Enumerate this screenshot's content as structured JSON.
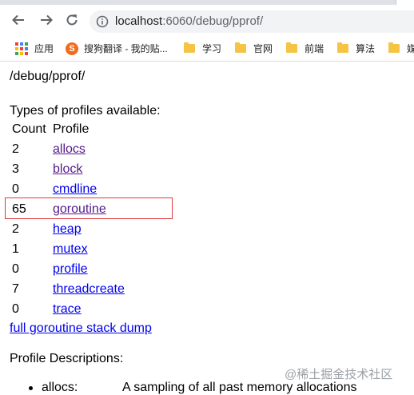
{
  "browser": {
    "url_host": "localhost",
    "url_rest": ":6060/debug/pprof/",
    "icons": [
      "back-arrow-icon",
      "forward-arrow-icon",
      "reload-icon",
      "info-icon"
    ]
  },
  "bookmarks": [
    {
      "label": "应用",
      "icon": "apps-grid-icon"
    },
    {
      "label": "搜狗翻译 - 我的贴...",
      "icon": "sogou-icon"
    },
    {
      "label": "学习",
      "icon": "folder-icon"
    },
    {
      "label": "官网",
      "icon": "folder-icon"
    },
    {
      "label": "前端",
      "icon": "folder-icon"
    },
    {
      "label": "算法",
      "icon": "folder-icon"
    },
    {
      "label": "媒",
      "icon": "folder-icon"
    }
  ],
  "page": {
    "title": "/debug/pprof/",
    "types_heading": "Types of profiles available:",
    "col_count": "Count",
    "col_profile": "Profile",
    "profiles": [
      {
        "count": "2",
        "name": "allocs",
        "visited": true
      },
      {
        "count": "3",
        "name": "block",
        "visited": true
      },
      {
        "count": "0",
        "name": "cmdline",
        "visited": false
      },
      {
        "count": "65",
        "name": "goroutine",
        "visited": true,
        "highlighted": true
      },
      {
        "count": "2",
        "name": "heap",
        "visited": false
      },
      {
        "count": "1",
        "name": "mutex",
        "visited": false
      },
      {
        "count": "0",
        "name": "profile",
        "visited": false
      },
      {
        "count": "7",
        "name": "threadcreate",
        "visited": false
      },
      {
        "count": "0",
        "name": "trace",
        "visited": false
      }
    ],
    "full_dump": "full goroutine stack dump",
    "desc_heading": "Profile Descriptions:",
    "descriptions": [
      {
        "name": "allocs:",
        "text": "A sampling of all past memory allocations"
      }
    ]
  },
  "watermark": "@稀土掘金技术社区",
  "colors": {
    "link": "#0000ee",
    "visited": "#551a8b",
    "highlight": "#e0373a"
  }
}
